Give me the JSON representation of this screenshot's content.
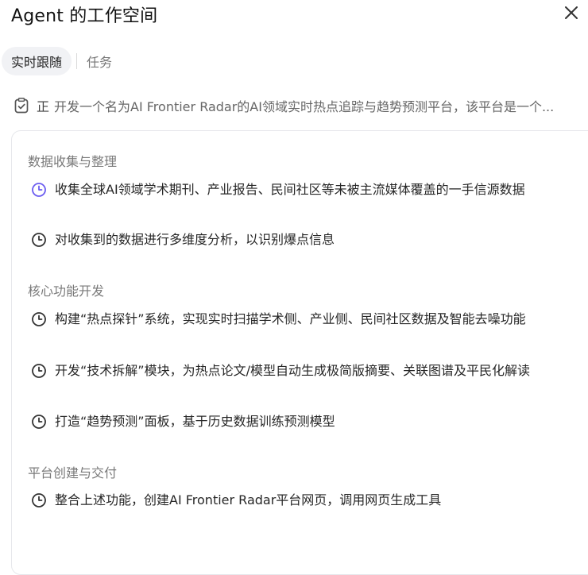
{
  "header": {
    "title": "Agent 的工作空间"
  },
  "tabs": [
    {
      "label": "实时跟随",
      "active": true
    },
    {
      "label": "任务",
      "active": false
    }
  ],
  "task": {
    "prefix": "正",
    "text": "开发一个名为AI Frontier Radar的AI领域实时热点追踪与趋势预测平台，该平台是一个..."
  },
  "sections": [
    {
      "title": "数据收集与整理",
      "items": [
        {
          "text": "收集全球AI领域学术期刊、产业报告、民间社区等未被主流媒体覆盖的一手信源数据",
          "icon": "clock-icon",
          "status": "active"
        },
        {
          "text": "对收集到的数据进行多维度分析，以识别爆点信息",
          "icon": "clock-icon",
          "status": "pending"
        }
      ]
    },
    {
      "title": "核心功能开发",
      "items": [
        {
          "text": "构建“热点探针”系统，实现实时扫描学术侧、产业侧、民间社区数据及智能去噪功能",
          "icon": "clock-icon",
          "status": "pending"
        },
        {
          "text": "开发“技术拆解”模块，为热点论文/模型自动生成极简版摘要、关联图谱及平民化解读",
          "icon": "clock-icon",
          "status": "pending"
        },
        {
          "text": "打造“趋势预测”面板，基于历史数据训练预测模型",
          "icon": "clock-icon",
          "status": "pending"
        }
      ]
    },
    {
      "title": "平台创建与交付",
      "items": [
        {
          "text": "整合上述功能，创建AI Frontier Radar平台网页，调用网页生成工具",
          "icon": "clock-icon",
          "status": "pending"
        }
      ]
    }
  ],
  "colors": {
    "active_icon": "#6b5cf0",
    "pending_icon": "#333333",
    "section_title": "#7a7a7a"
  }
}
